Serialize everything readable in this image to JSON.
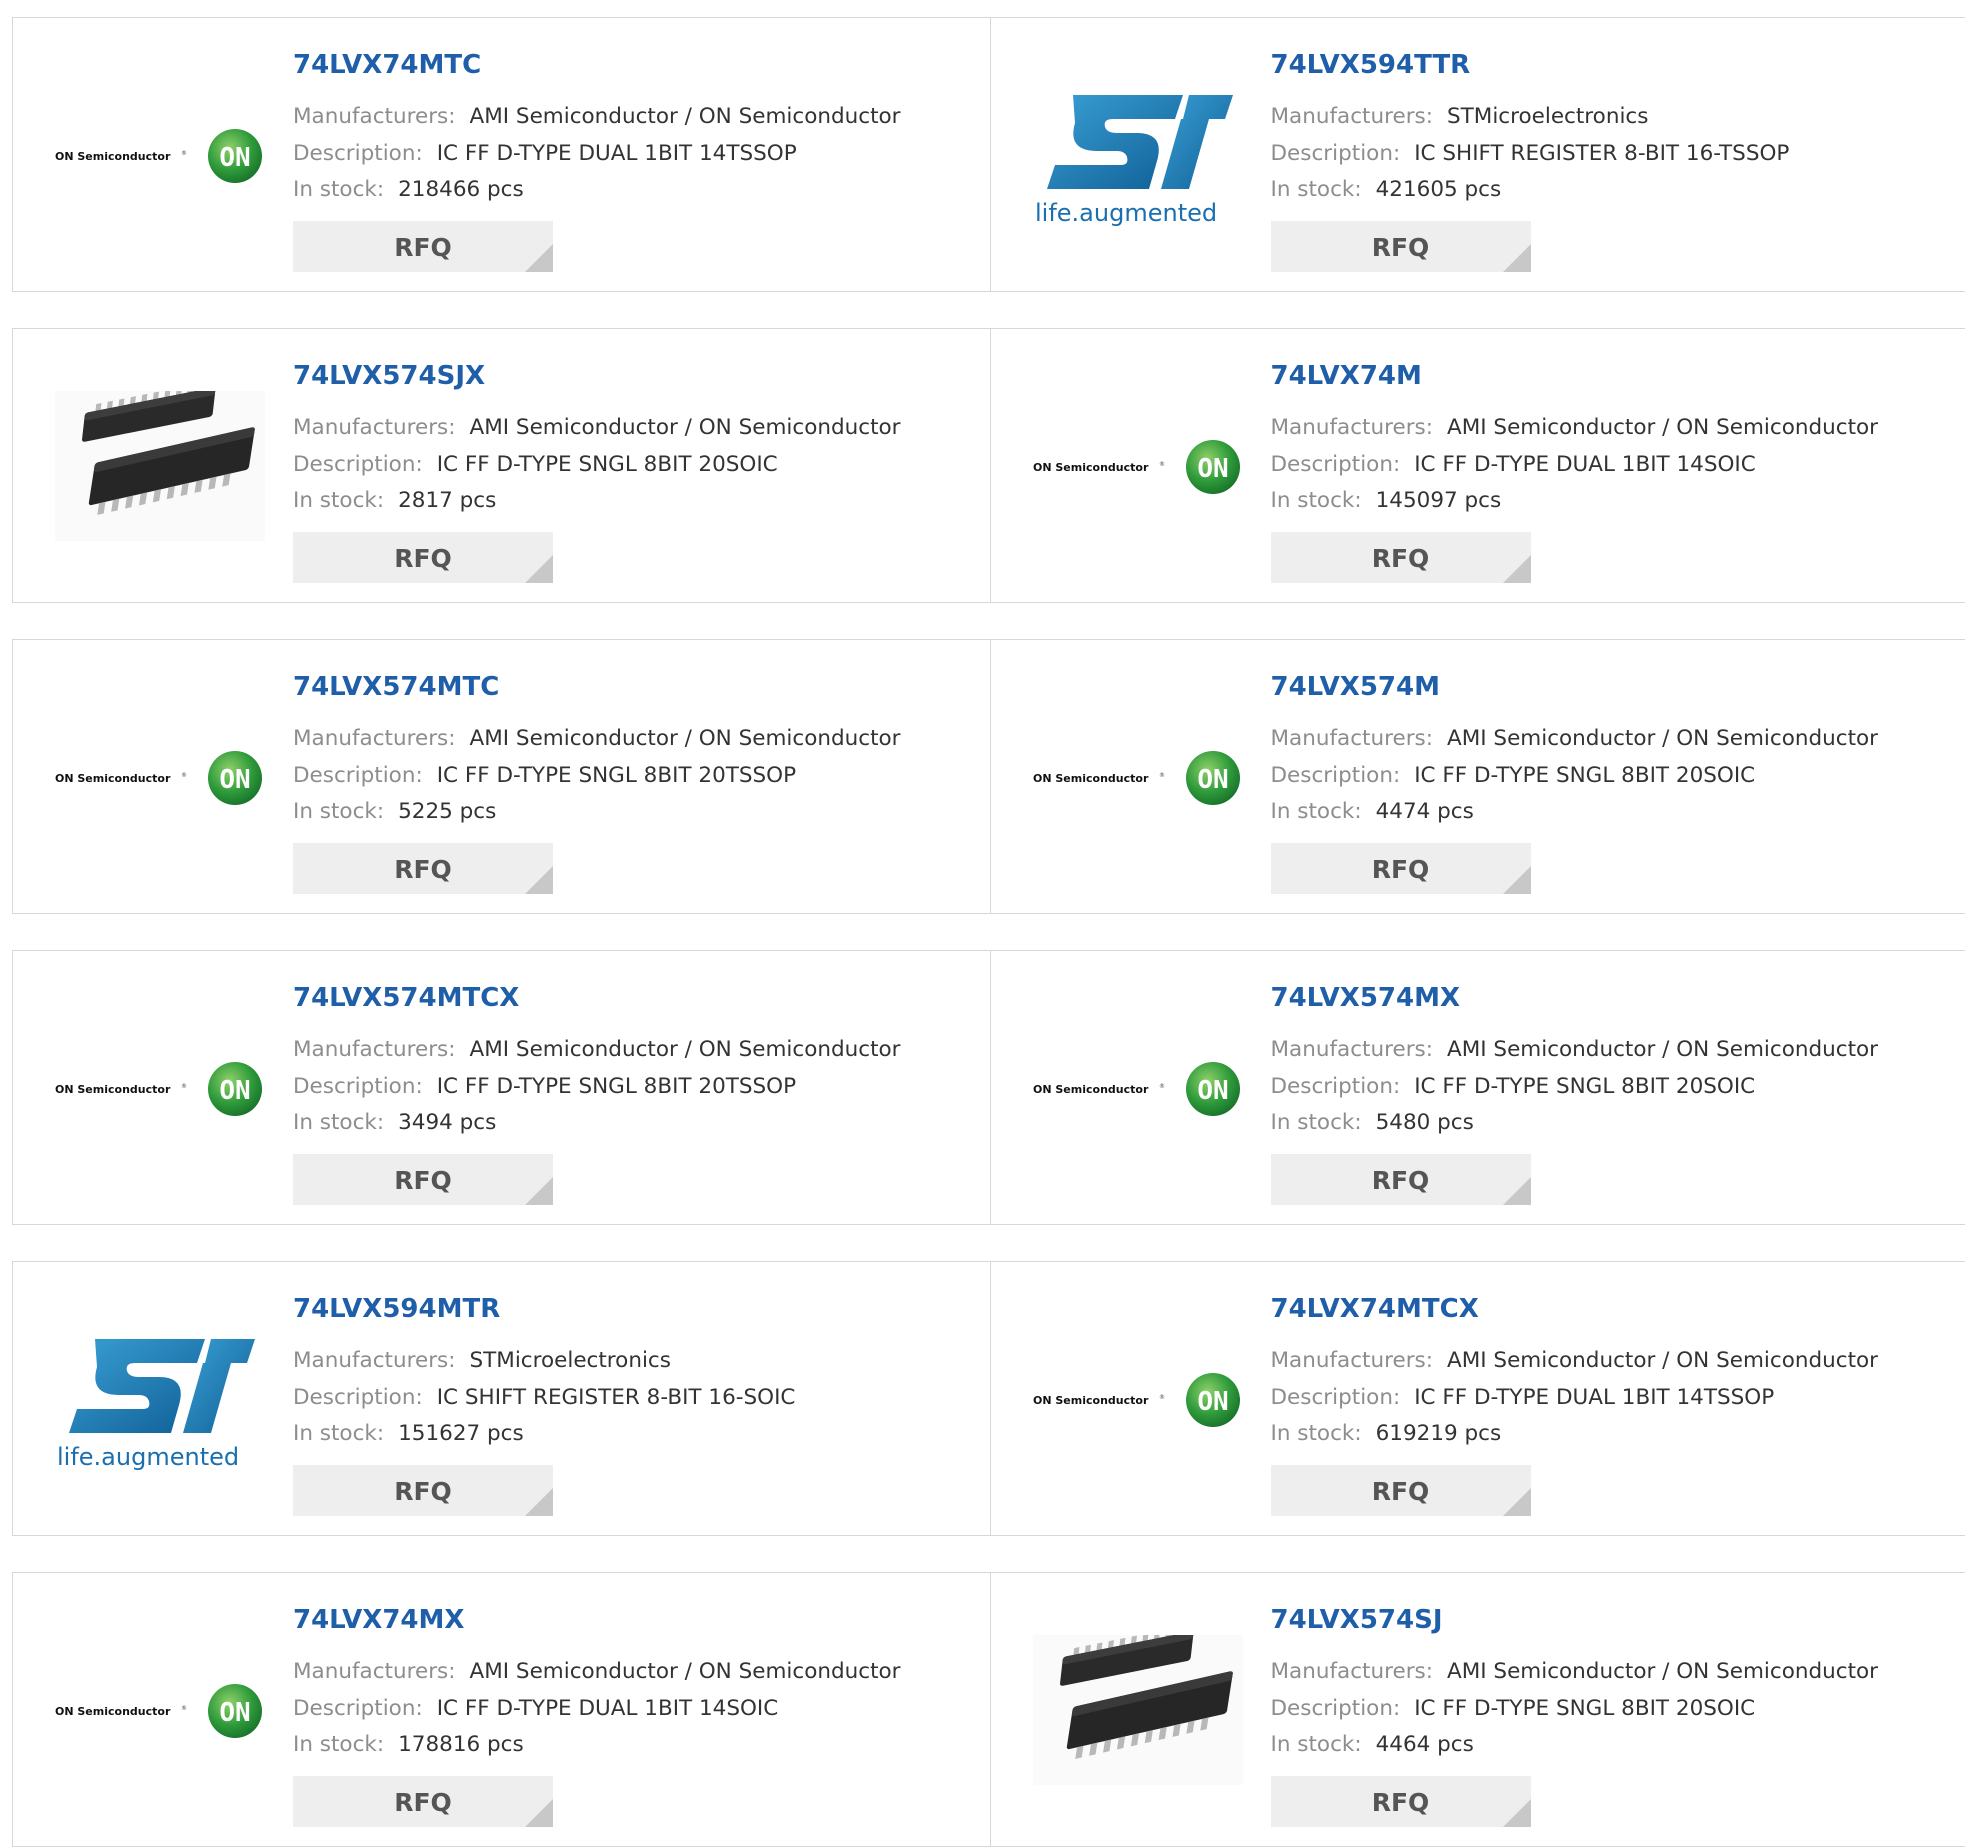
{
  "labels": {
    "manufacturers": "Manufacturers:",
    "description": "Description:",
    "in_stock": "In stock:",
    "rfq": "RFQ"
  },
  "logo_text": {
    "on_semi_name": "ON Semiconductor",
    "on_semi_mark": "ON",
    "st_tagline": "life.augmented"
  },
  "colors": {
    "title": "#1f5ea8",
    "label": "#8d8d8d",
    "value": "#333333",
    "on_green": "#2e9a3a",
    "st_blue": "#1a7fb8"
  },
  "products": [
    {
      "part": "74LVX74MTC",
      "manufacturer": "AMI Semiconductor / ON Semiconductor",
      "description": "IC FF D-TYPE DUAL 1BIT 14TSSOP",
      "stock": "218466 pcs",
      "logo": "on-semiconductor-logo"
    },
    {
      "part": "74LVX594TTR",
      "manufacturer": "STMicroelectronics",
      "description": "IC SHIFT REGISTER 8-BIT 16-TSSOP",
      "stock": "421605 pcs",
      "logo": "st-logo"
    },
    {
      "part": "74LVX574SJX",
      "manufacturer": "AMI Semiconductor / ON Semiconductor",
      "description": "IC FF D-TYPE SNGL 8BIT 20SOIC",
      "stock": "2817 pcs",
      "logo": "chip-image"
    },
    {
      "part": "74LVX74M",
      "manufacturer": "AMI Semiconductor / ON Semiconductor",
      "description": "IC FF D-TYPE DUAL 1BIT 14SOIC",
      "stock": "145097 pcs",
      "logo": "on-semiconductor-logo"
    },
    {
      "part": "74LVX574MTC",
      "manufacturer": "AMI Semiconductor / ON Semiconductor",
      "description": "IC FF D-TYPE SNGL 8BIT 20TSSOP",
      "stock": "5225 pcs",
      "logo": "on-semiconductor-logo"
    },
    {
      "part": "74LVX574M",
      "manufacturer": "AMI Semiconductor / ON Semiconductor",
      "description": "IC FF D-TYPE SNGL 8BIT 20SOIC",
      "stock": "4474 pcs",
      "logo": "on-semiconductor-logo"
    },
    {
      "part": "74LVX574MTCX",
      "manufacturer": "AMI Semiconductor / ON Semiconductor",
      "description": "IC FF D-TYPE SNGL 8BIT 20TSSOP",
      "stock": "3494 pcs",
      "logo": "on-semiconductor-logo"
    },
    {
      "part": "74LVX574MX",
      "manufacturer": "AMI Semiconductor / ON Semiconductor",
      "description": "IC FF D-TYPE SNGL 8BIT 20SOIC",
      "stock": "5480 pcs",
      "logo": "on-semiconductor-logo"
    },
    {
      "part": "74LVX594MTR",
      "manufacturer": "STMicroelectronics",
      "description": "IC SHIFT REGISTER 8-BIT 16-SOIC",
      "stock": "151627 pcs",
      "logo": "st-logo"
    },
    {
      "part": "74LVX74MTCX",
      "manufacturer": "AMI Semiconductor / ON Semiconductor",
      "description": "IC FF D-TYPE DUAL 1BIT 14TSSOP",
      "stock": "619219 pcs",
      "logo": "on-semiconductor-logo"
    },
    {
      "part": "74LVX74MX",
      "manufacturer": "AMI Semiconductor / ON Semiconductor",
      "description": "IC FF D-TYPE DUAL 1BIT 14SOIC",
      "stock": "178816 pcs",
      "logo": "on-semiconductor-logo"
    },
    {
      "part": "74LVX574SJ",
      "manufacturer": "AMI Semiconductor / ON Semiconductor",
      "description": "IC FF D-TYPE SNGL 8BIT 20SOIC",
      "stock": "4464 pcs",
      "logo": "chip-image"
    }
  ]
}
